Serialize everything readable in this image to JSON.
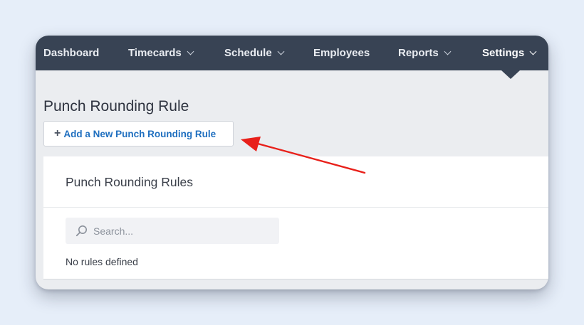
{
  "nav": {
    "items": [
      {
        "label": "Dashboard",
        "has_dropdown": false,
        "active": false
      },
      {
        "label": "Timecards",
        "has_dropdown": true,
        "active": false
      },
      {
        "label": "Schedule",
        "has_dropdown": true,
        "active": false
      },
      {
        "label": "Employees",
        "has_dropdown": false,
        "active": false
      },
      {
        "label": "Reports",
        "has_dropdown": true,
        "active": false
      },
      {
        "label": "Settings",
        "has_dropdown": true,
        "active": true
      }
    ]
  },
  "page": {
    "title": "Punch Rounding Rule",
    "add_button_label": "Add a New Punch Rounding Rule"
  },
  "panel": {
    "title": "Punch Rounding Rules",
    "search_placeholder": "Search...",
    "empty_text": "No rules defined"
  },
  "icons": {
    "add": "plus-icon",
    "search": "search-icon",
    "dropdown": "chevron-down-icon"
  },
  "colors": {
    "navbar": "#384354",
    "link_blue": "#1f6fbf",
    "annotation_arrow": "#e8201a",
    "background": "#e6eef9"
  }
}
